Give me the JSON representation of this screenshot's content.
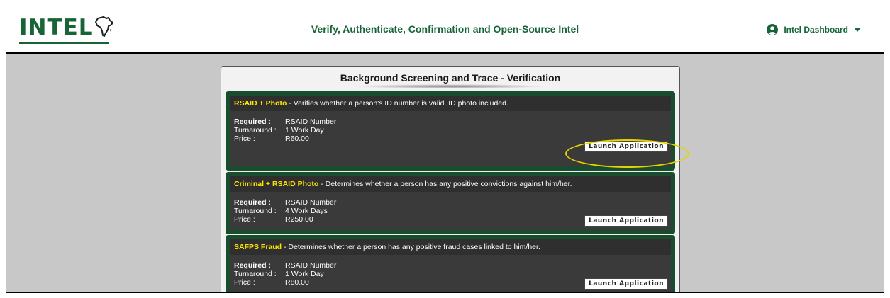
{
  "header": {
    "logo_text": "INTEL",
    "tagline": "Verify, Authenticate, Confirmation and Open-Source Intel",
    "user_menu_label": "Intel Dashboard"
  },
  "panel": {
    "title": "Background Screening and Trace - Verification"
  },
  "cards": [
    {
      "name": "RSAID + Photo",
      "description": " - Verifies whether a person's ID number is valid. ID photo included.",
      "required_label": "Required :",
      "required_value": "RSAID Number",
      "turnaround_label": "Turnaround :",
      "turnaround_value": "1 Work Day",
      "price_label": "Price :",
      "price_value": "R60.00",
      "button_label": "Launch Application"
    },
    {
      "name": "Criminal + RSAID Photo",
      "description": " - Determines whether a person has any positive convictions against him/her.",
      "required_label": "Required :",
      "required_value": "RSAID Number",
      "turnaround_label": "Turnaround :",
      "turnaround_value": "4 Work Days",
      "price_label": "Price :",
      "price_value": "R250.00",
      "button_label": "Launch Application"
    },
    {
      "name": "SAFPS Fraud",
      "description": " - Determines whether a person has any positive fraud cases linked to him/her.",
      "required_label": "Required :",
      "required_value": "RSAID Number",
      "turnaround_label": "Turnaround :",
      "turnaround_value": "1 Work Day",
      "price_label": "Price :",
      "price_value": "R80.00",
      "button_label": "Launch Application"
    }
  ],
  "colors": {
    "brand_green": "#176437",
    "card_border_green": "#1a4d2e",
    "card_name_yellow": "#ffe600",
    "highlight_yellow": "#e6d300"
  },
  "icons": {
    "logo": "africa-map-icon",
    "user": "user-circle-icon",
    "dropdown": "caret-down-icon"
  }
}
